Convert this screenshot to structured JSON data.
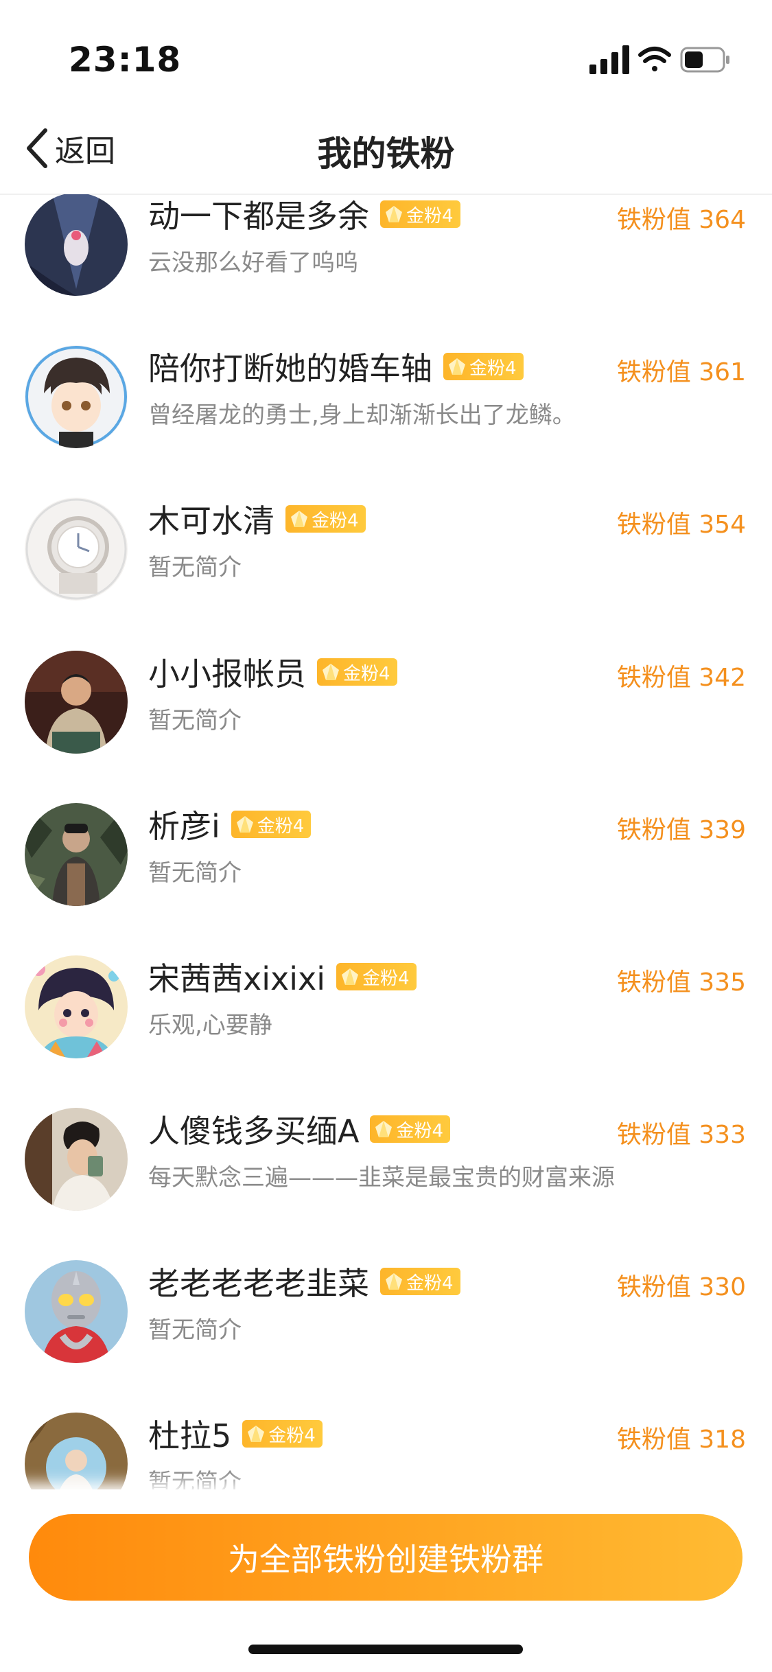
{
  "status_bar": {
    "time": "23:18"
  },
  "nav": {
    "back_label": "返回",
    "title": "我的铁粉"
  },
  "rows": [
    {
      "name": "动一下都是多余",
      "badge": "金粉4",
      "bio": "云没那么好看了呜呜",
      "fan_value": "铁粉值 364"
    },
    {
      "name": "陪你打断她的婚车轴",
      "badge": "金粉4",
      "bio": "曾经屠龙的勇士,身上却渐渐长出了龙鳞。",
      "fan_value": "铁粉值 361"
    },
    {
      "name": "木可水清",
      "badge": "金粉4",
      "bio": "暂无简介",
      "fan_value": "铁粉值 354"
    },
    {
      "name": "小小报帐员",
      "badge": "金粉4",
      "bio": "暂无简介",
      "fan_value": "铁粉值 342"
    },
    {
      "name": "析彦i",
      "badge": "金粉4",
      "bio": "暂无简介",
      "fan_value": "铁粉值 339"
    },
    {
      "name": "宋茜茜xixixi",
      "badge": "金粉4",
      "bio": "乐观,心要静",
      "fan_value": "铁粉值 335"
    },
    {
      "name": "人傻钱多买缅A",
      "badge": "金粉4",
      "bio": "每天默念三遍———韭菜是最宝贵的财富来源",
      "fan_value": "铁粉值 333"
    },
    {
      "name": "老老老老老韭菜",
      "badge": "金粉4",
      "bio": "暂无简介",
      "fan_value": "铁粉值 330"
    },
    {
      "name": "杜拉5",
      "badge": "金粉4",
      "bio": "暂无简介",
      "fan_value": "铁粉值 318"
    }
  ],
  "cta": {
    "label": "为全部铁粉创建铁粉群"
  },
  "colors": {
    "accent": "#f4901e",
    "badge": "#fdb52a",
    "cta_start": "#ff8a0c",
    "cta_end": "#ffbb33"
  }
}
